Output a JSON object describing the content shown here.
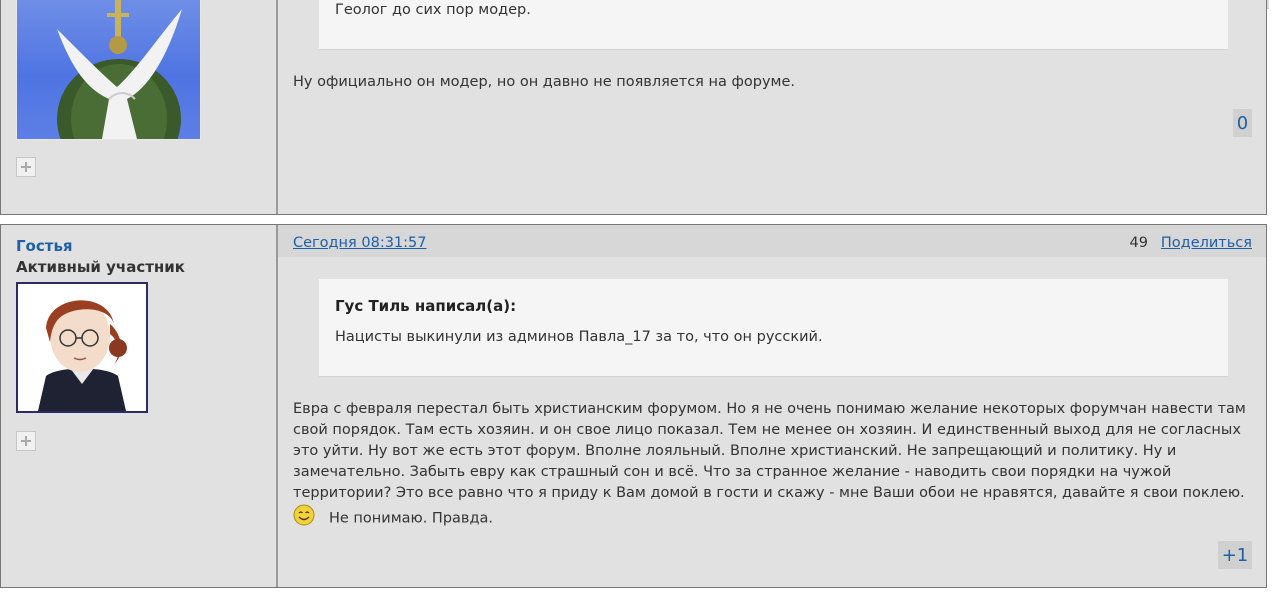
{
  "post_prev": {
    "quote_text": "Геолог до сих пор модер.",
    "body": "Ну официально он модер, но он давно не появляется на форуме.",
    "vote": "0",
    "plus_icon": "plus-icon"
  },
  "post": {
    "username": "Гостья",
    "rank": "Активный участник",
    "date": "Сегодня 08:31:57",
    "number": "49",
    "share_label": "Поделиться",
    "quote_author": "Гус Тиль написал(а):",
    "quote_text": "Нацисты выкинули из админов Павла_17 за то, что он русский.",
    "body_lines": [
      "Евра с февраля перестал быть христианским форумом.  Но я не очень понимаю желание некоторых форумчан навести там",
      "свой порядок. Там есть хозяин. и он свое лицо показал.  Тем не менее он хозяин. И единственный выход для не согласных",
      "это уйти. Ну вот же есть этот форум. Вполне лояльный.  Вполне христианский. Не запрещающий и политику. Ну и",
      "замечательно.  Забыть евру как страшный сон и всё.   Что за странное желание - наводить свои порядки на чужой",
      "территории?  Это все равно что я приду к Вам домой в гости и скажу - мне Ваши обои не нравятся, давайте я свои поклею."
    ],
    "body_last": "Не понимаю. Правда.",
    "smiley_icon": "smiley-icon",
    "vote": "+1"
  },
  "colors": {
    "link": "#1f5fa6",
    "post_bg": "#e1e1e1",
    "quote_bg": "#f5f5f5"
  }
}
